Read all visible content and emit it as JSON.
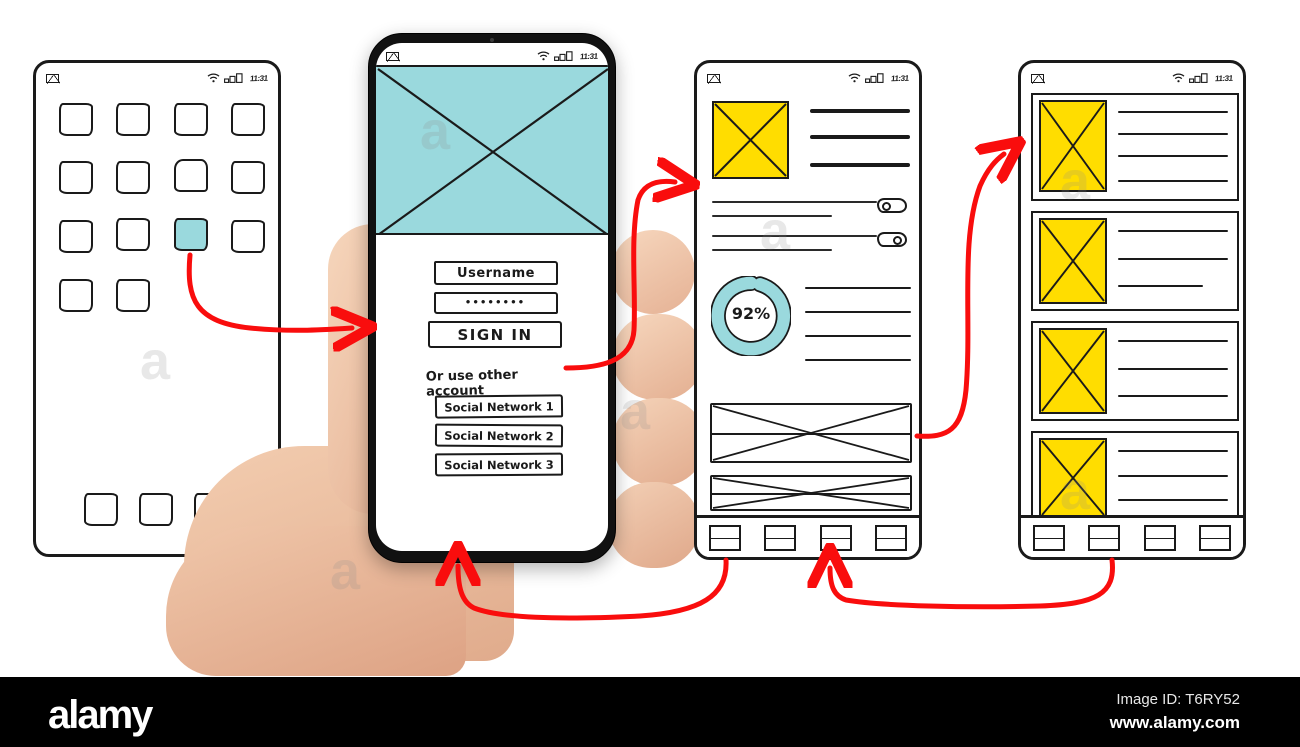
{
  "scene": {
    "title": "UX wireframe storyboard — mobile app flow sketched on paper with hand holding phone",
    "colors": {
      "teal": "#9ad9dd",
      "yellow": "#ffdd00",
      "arrow_red": "#f90d0d",
      "ink": "#1a1a1a",
      "skin": "#eec3a6",
      "footer_bg": "#000000"
    }
  },
  "status_bar": {
    "mail_icon": "envelope-icon",
    "wifi_icon": "wifi-icon",
    "signal_icon": "signal-icon",
    "time": "11:31"
  },
  "screens": [
    {
      "id": "home-screen",
      "name": "App launcher / home screen",
      "grid_rows": [
        4,
        4,
        4,
        2
      ],
      "highlighted_icon": {
        "row": 3,
        "col": 3,
        "color": "#9ad9dd"
      },
      "dock_icons": 3
    },
    {
      "id": "login-screen",
      "name": "Sign in screen (on device)",
      "hero": {
        "type": "image-placeholder",
        "color": "#9ad9dd"
      },
      "fields": [
        {
          "name": "username-field",
          "value": "Username",
          "type": "text"
        },
        {
          "name": "password-field",
          "value": "••••••••",
          "type": "password"
        }
      ],
      "primary_button": "SIGN IN",
      "divider_text": "Or use other account",
      "social_buttons": [
        "Social Network 1",
        "Social Network 2",
        "Social Network 3"
      ]
    },
    {
      "id": "dashboard-screen",
      "name": "Dashboard / detail screen",
      "hero_thumb": {
        "type": "image-placeholder",
        "color": "#ffdd00"
      },
      "headline_lines": 3,
      "setting_rows": [
        {
          "label_lines": 2,
          "toggle": "on"
        },
        {
          "label_lines": 2,
          "toggle": "off"
        }
      ],
      "progress_ring": {
        "label": "92%",
        "value": 92,
        "color": "#9ad9dd"
      },
      "body_lines": 4,
      "banners": 2,
      "tab_items": 4
    },
    {
      "id": "list-screen",
      "name": "List / feed screen",
      "list_items": [
        {
          "thumb_color": "#ffdd00",
          "text_lines": 4
        },
        {
          "thumb_color": "#ffdd00",
          "text_lines": 3
        },
        {
          "thumb_color": "#ffdd00",
          "text_lines": 3
        },
        {
          "thumb_color": "#ffdd00",
          "text_lines": 3
        }
      ],
      "tab_items": 4
    }
  ],
  "flow_arrows": [
    {
      "name": "home-to-login",
      "from": "home-screen highlighted app icon",
      "to": "login-screen"
    },
    {
      "name": "login-to-dashboard",
      "from": "SIGN IN button",
      "to": "dashboard-screen"
    },
    {
      "name": "dashboard-to-list",
      "from": "dashboard banner",
      "to": "list-screen"
    },
    {
      "name": "dashboard-back-to-login",
      "from": "dashboard tab bar",
      "to": "phone device"
    },
    {
      "name": "list-back-to-dashboard",
      "from": "list tab bar",
      "to": "dashboard tab bar"
    }
  ],
  "watermark": {
    "text": "a"
  },
  "footer": {
    "brand": "alamy",
    "image_id": "Image ID: T6RY52",
    "url": "www.alamy.com"
  }
}
